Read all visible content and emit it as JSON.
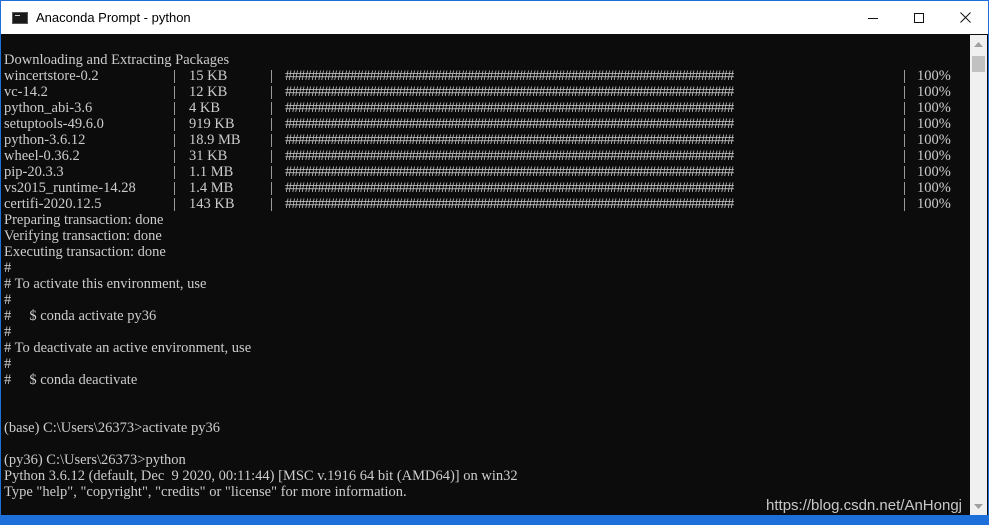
{
  "window": {
    "title": "Anaconda Prompt - python",
    "app_icon": "console-icon",
    "controls": {
      "minimize_icon": "minimize-icon",
      "maximize_icon": "maximize-icon",
      "close_icon": "close-icon"
    }
  },
  "terminal": {
    "header": "Downloading and Extracting Packages",
    "separator": "|",
    "progress_bar": "#####################################################################",
    "packages": [
      {
        "name": "wincertstore-0.2",
        "size": "15 KB",
        "pct": "100%"
      },
      {
        "name": "vc-14.2",
        "size": "12 KB",
        "pct": "100%"
      },
      {
        "name": "python_abi-3.6",
        "size": "4 KB",
        "pct": "100%"
      },
      {
        "name": "setuptools-49.6.0",
        "size": "919 KB",
        "pct": "100%"
      },
      {
        "name": "python-3.6.12",
        "size": "18.9 MB",
        "pct": "100%"
      },
      {
        "name": "wheel-0.36.2",
        "size": "31 KB",
        "pct": "100%"
      },
      {
        "name": "pip-20.3.3",
        "size": "1.1 MB",
        "pct": "100%"
      },
      {
        "name": "vs2015_runtime-14.28",
        "size": "1.4 MB",
        "pct": "100%"
      },
      {
        "name": "certifi-2020.12.5",
        "size": "143 KB",
        "pct": "100%"
      }
    ],
    "lines": [
      "Preparing transaction: done",
      "Verifying transaction: done",
      "Executing transaction: done",
      "#",
      "# To activate this environment, use",
      "#",
      "#     $ conda activate py36",
      "#",
      "# To deactivate an active environment, use",
      "#",
      "#     $ conda deactivate",
      "",
      "",
      "(base) C:\\Users\\26373>activate py36",
      "",
      "(py36) C:\\Users\\26373>python",
      "Python 3.6.12 (default, Dec  9 2020, 00:11:44) [MSC v.1916 64 bit (AMD64)] on win32",
      "Type \"help\", \"copyright\", \"credits\" or \"license\" for more information."
    ],
    "prompt": ">>>"
  },
  "watermark": "https://blog.csdn.net/AnHongj",
  "colors": {
    "terminal_bg": "#0c0c0c",
    "terminal_fg": "#cccccc",
    "window_border": "#1e6fd9"
  }
}
